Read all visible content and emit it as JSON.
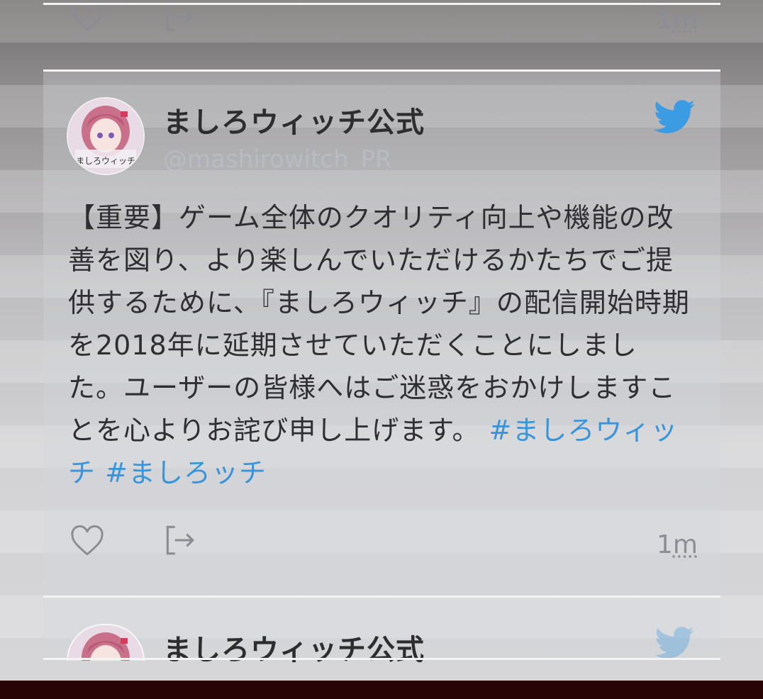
{
  "tweets": [
    {
      "time_num": "1",
      "time_unit": "m"
    },
    {
      "author": "ましろウィッチ公式",
      "handle": "@mashirowitch_PR",
      "avatar_text": "ましろウィッチ",
      "text": "【重要】ゲーム全体のクオリティ向上や機能の改善を図り、より楽しんでいただけるかたちでご提供するために、『ましろウィッチ』の配信開始時期を2018年に延期させていただくことにしました。ユーザーの皆様へはご迷惑をおかけしますことを心よりお詫び申し上げます。",
      "hashtags": [
        "#ましろウィッチ",
        "#ましろッチ"
      ],
      "time_num": "1",
      "time_unit": "m"
    },
    {
      "author": "ましろウィッチ公式"
    }
  ],
  "icons": {
    "like": "heart-outline-icon",
    "share": "share-out-icon",
    "brand": "twitter-bird-icon"
  },
  "colors": {
    "hashtag": "#3a95d8",
    "bird": "#3b9be3",
    "bottom_bar": "#290404"
  }
}
